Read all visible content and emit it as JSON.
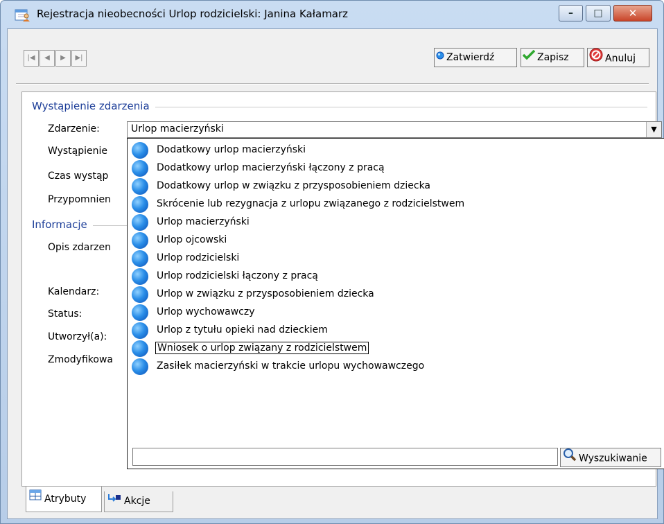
{
  "window": {
    "title": "Rejestracja nieobecności Urlop rodzicielski: Janina Kałamarz",
    "controls": {
      "minimize": "–",
      "maximize": "□",
      "close": "✕"
    }
  },
  "toolbar": {
    "nav": [
      "|◀",
      "◀",
      "▶",
      "▶|"
    ],
    "confirm_label": "Zatwierdź",
    "save_label": "Zapisz",
    "cancel_label": "Anuluj"
  },
  "group_occurrence": {
    "title": "Wystąpienie zdarzenia",
    "event_label": "Zdarzenie:",
    "event_value": "Urlop macierzyński",
    "occurrence_label": "Wystąpienie",
    "time_label": "Czas wystąp",
    "reminder_label": "Przypomnien"
  },
  "group_info": {
    "title": "Informacje",
    "description_label": "Opis zdarzen",
    "calendar_label": "Kalendarz:",
    "status_label": "Status:",
    "created_label": "Utworzył(a):",
    "modified_label": "Zmodyfikowa"
  },
  "dropdown": {
    "items": [
      "Dodatkowy urlop macierzyński",
      "Dodatkowy urlop macierzyński łączony z pracą",
      "Dodatkowy urlop w związku z przysposobieniem dziecka",
      "Skrócenie lub rezygnacja z urlopu związanego z rodzicielstwem",
      "Urlop macierzyński",
      "Urlop ojcowski",
      "Urlop rodzicielski",
      "Urlop rodzicielski łączony z pracą",
      "Urlop w związku z przysposobieniem dziecka",
      "Urlop wychowawczy",
      "Urlop z tytułu opieki nad dzieckiem",
      "Wniosek o urlop związany z rodzicielstwem",
      "Zasiłek macierzyński w trakcie urlopu wychowawczego"
    ],
    "focused_index": 11,
    "search_button_label": "Wyszukiwanie",
    "search_value": ""
  },
  "tabs": [
    {
      "label": "Atrybuty",
      "active": true
    },
    {
      "label": "Akcje",
      "active": false
    }
  ],
  "colors": {
    "group_title": "#1e3f99",
    "item_bullet": "#2a8ee8",
    "window_frame": "#b7cde8"
  }
}
